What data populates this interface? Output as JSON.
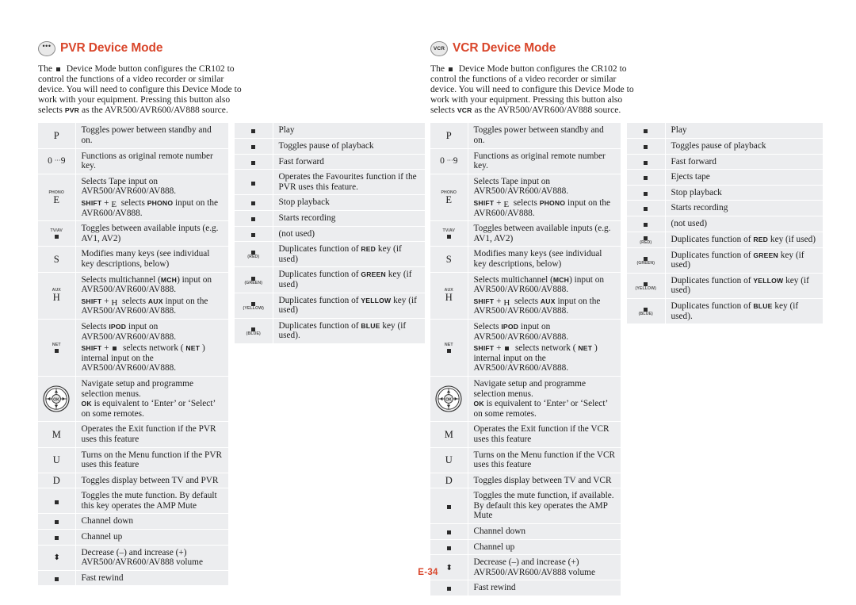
{
  "page": {
    "number": "E-34"
  },
  "sections": [
    {
      "id": "pvr",
      "icon_label": "•••",
      "icon_kind": "dots",
      "title": "PVR Device Mode",
      "intro": {
        "before_key": "The",
        "after_key": "Device Mode button configures the CR102 to control the functions of a video recorder or similar device. You will need to configure this Device Mode to work with your equipment. Pressing this button also selects",
        "source_name": "PVR",
        "tail": "as the AVR500/AVR600/AV888 source."
      },
      "main_rows": [
        {
          "key": {
            "type": "letter",
            "text": "P"
          },
          "lines": [
            {
              "text": "Toggles power between standby and on."
            }
          ]
        },
        {
          "key": {
            "type": "range",
            "from": "0",
            "dots": "···",
            "to": "9"
          },
          "lines": [
            {
              "text": "Functions as original remote number key."
            }
          ]
        },
        {
          "key": {
            "type": "label-letter",
            "tiny": "PHONO",
            "text": "E"
          },
          "lines": [
            {
              "text": "Selects Tape input on AVR500/AVR600/AV888."
            },
            {
              "type": "shift",
              "shift": "SHIFT",
              "plus": "+",
              "keyglyph": "E",
              "mid": "selects",
              "caps": "PHONO",
              "after": "input on the AVR600/AV888."
            }
          ]
        },
        {
          "key": {
            "type": "label-square",
            "tiny": "TV/AV"
          },
          "lines": [
            {
              "text": "Toggles between available inputs (e.g. AV1, AV2)"
            }
          ]
        },
        {
          "key": {
            "type": "letter",
            "text": "S"
          },
          "lines": [
            {
              "text": "Modifies many keys (see individual key descriptions, below)"
            }
          ]
        },
        {
          "key": {
            "type": "label-letter",
            "tiny": "AUX",
            "text": "H"
          },
          "lines": [
            {
              "type": "caps-inline",
              "pre": "Selects multichannel (",
              "caps": "MCH",
              "post": ") input on AVR500/AVR600/AV888."
            },
            {
              "type": "shift",
              "shift": "SHIFT",
              "plus": "+",
              "keyglyph": "H",
              "mid": "selects",
              "caps": "AUX",
              "after": "input on the AVR500/AVR600/AV888."
            }
          ]
        },
        {
          "key": {
            "type": "label-square",
            "tiny": "NET"
          },
          "lines": [
            {
              "type": "caps-inline",
              "pre": "Selects ",
              "caps": "IPOD",
              "post": " input on AVR500/AVR600/AV888."
            },
            {
              "type": "shift",
              "shift": "SHIFT",
              "plus": "+",
              "keyglyph": "square",
              "mid": "selects network (",
              "caps": "NET",
              "after": ") internal input on the AVR500/AVR600/AV888."
            }
          ]
        },
        {
          "key": {
            "type": "navpad"
          },
          "lines": [
            {
              "text": "Navigate setup and programme selection menus."
            },
            {
              "type": "caps-lead",
              "caps": "OK",
              "post": "is equivalent to ‘Enter’ or ‘Select’ on some remotes."
            }
          ]
        },
        {
          "key": {
            "type": "letter",
            "text": "M"
          },
          "lines": [
            {
              "text": "Operates the Exit function if the PVR uses this feature"
            }
          ]
        },
        {
          "key": {
            "type": "letter",
            "text": "U"
          },
          "lines": [
            {
              "text": "Turns on the Menu function if the PVR uses this feature"
            }
          ]
        },
        {
          "key": {
            "type": "letter",
            "text": "D"
          },
          "lines": [
            {
              "text": "Toggles display between TV and PVR"
            }
          ]
        },
        {
          "key": {
            "type": "square"
          },
          "lines": [
            {
              "text": "Toggles the mute function. By default this key operates the AMP Mute"
            }
          ]
        },
        {
          "key": {
            "type": "square"
          },
          "lines": [
            {
              "text": "Channel down"
            }
          ]
        },
        {
          "key": {
            "type": "square"
          },
          "lines": [
            {
              "text": "Channel up"
            }
          ]
        },
        {
          "key": {
            "type": "plusminus"
          },
          "lines": [
            {
              "text": "Decrease (–) and increase (+) AVR500/AVR600/AV888 volume"
            }
          ]
        },
        {
          "key": {
            "type": "square"
          },
          "lines": [
            {
              "text": "Fast rewind"
            }
          ]
        }
      ],
      "aux_rows": [
        {
          "key": {
            "type": "square"
          },
          "lines": [
            {
              "text": "Play"
            }
          ]
        },
        {
          "key": {
            "type": "square"
          },
          "lines": [
            {
              "text": "Toggles pause of playback"
            }
          ]
        },
        {
          "key": {
            "type": "square"
          },
          "lines": [
            {
              "text": "Fast forward"
            }
          ]
        },
        {
          "key": {
            "type": "square"
          },
          "lines": [
            {
              "text": "Operates the Favourites function if the PVR uses this feature."
            }
          ]
        },
        {
          "key": {
            "type": "square"
          },
          "lines": [
            {
              "text": "Stop playback"
            }
          ]
        },
        {
          "key": {
            "type": "square"
          },
          "lines": [
            {
              "text": "Starts recording"
            }
          ]
        },
        {
          "key": {
            "type": "square"
          },
          "lines": [
            {
              "text": "(not used)"
            }
          ]
        },
        {
          "key": {
            "type": "square-label",
            "tiny": "(RED)"
          },
          "lines": [
            {
              "type": "caps-inline",
              "pre": "Duplicates function of ",
              "caps": "RED",
              "post": " key (if used)"
            }
          ]
        },
        {
          "key": {
            "type": "square-label",
            "tiny": "(GREEN)"
          },
          "lines": [
            {
              "type": "caps-inline",
              "pre": "Duplicates function of ",
              "caps": "GREEN",
              "post": " key (if used)"
            }
          ]
        },
        {
          "key": {
            "type": "square-label",
            "tiny": "(YELLOW)"
          },
          "lines": [
            {
              "type": "caps-inline",
              "pre": "Duplicates function of ",
              "caps": "YELLOW",
              "post": " key (if used)"
            }
          ]
        },
        {
          "key": {
            "type": "square-label",
            "tiny": "(BLUE)"
          },
          "lines": [
            {
              "type": "caps-inline",
              "pre": "Duplicates function of ",
              "caps": "BLUE",
              "post": " key (if used)."
            }
          ]
        }
      ]
    },
    {
      "id": "vcr",
      "icon_label": "VCR",
      "icon_kind": "text",
      "title": "VCR Device Mode",
      "intro": {
        "before_key": "The",
        "after_key": "Device Mode button configures the CR102 to control the functions of a video recorder or similar device. You will need to configure this Device Mode to work with your equipment. Pressing this button also selects",
        "source_name": "VCR",
        "tail": "as the AVR500/AVR600/AV888 source."
      },
      "main_rows": [
        {
          "key": {
            "type": "letter",
            "text": "P"
          },
          "lines": [
            {
              "text": "Toggles power between standby and on."
            }
          ]
        },
        {
          "key": {
            "type": "range",
            "from": "0",
            "dots": "···",
            "to": "9"
          },
          "lines": [
            {
              "text": "Functions as original remote number key."
            }
          ]
        },
        {
          "key": {
            "type": "label-letter",
            "tiny": "PHONO",
            "text": "E"
          },
          "lines": [
            {
              "text": "Selects Tape input on AVR500/AVR600/AV888."
            },
            {
              "type": "shift",
              "shift": "SHIFT",
              "plus": "+",
              "keyglyph": "E",
              "mid": "selects",
              "caps": "PHONO",
              "after": "input on the AVR600/AV888."
            }
          ]
        },
        {
          "key": {
            "type": "label-square",
            "tiny": "TV/AV"
          },
          "lines": [
            {
              "text": "Toggles between available inputs (e.g. AV1, AV2)"
            }
          ]
        },
        {
          "key": {
            "type": "letter",
            "text": "S"
          },
          "lines": [
            {
              "text": "Modifies many keys (see individual key descriptions, below)"
            }
          ]
        },
        {
          "key": {
            "type": "label-letter",
            "tiny": "AUX",
            "text": "H"
          },
          "lines": [
            {
              "type": "caps-inline",
              "pre": "Selects multichannel (",
              "caps": "MCH",
              "post": ") input on AVR500/AVR600/AV888."
            },
            {
              "type": "shift",
              "shift": "SHIFT",
              "plus": "+",
              "keyglyph": "H",
              "mid": "selects",
              "caps": "AUX",
              "after": "input on the AVR500/AVR600/AV888."
            }
          ]
        },
        {
          "key": {
            "type": "label-square",
            "tiny": "NET"
          },
          "lines": [
            {
              "type": "caps-inline",
              "pre": "Selects ",
              "caps": "IPOD",
              "post": " input on AVR500/AVR600/AV888."
            },
            {
              "type": "shift",
              "shift": "SHIFT",
              "plus": "+",
              "keyglyph": "square",
              "mid": "selects network (",
              "caps": "NET",
              "after": ") internal input on the AVR500/AVR600/AV888."
            }
          ]
        },
        {
          "key": {
            "type": "navpad"
          },
          "lines": [
            {
              "text": "Navigate setup and programme selection menus."
            },
            {
              "type": "caps-lead",
              "caps": "OK",
              "post": "is equivalent to ‘Enter’ or ‘Select’ on some remotes."
            }
          ]
        },
        {
          "key": {
            "type": "letter",
            "text": "M"
          },
          "lines": [
            {
              "text": "Operates the Exit function if the VCR uses this feature"
            }
          ]
        },
        {
          "key": {
            "type": "letter",
            "text": "U"
          },
          "lines": [
            {
              "text": "Turns on the Menu function if the VCR uses this feature"
            }
          ]
        },
        {
          "key": {
            "type": "letter",
            "text": "D"
          },
          "lines": [
            {
              "text": "Toggles display between TV and VCR"
            }
          ]
        },
        {
          "key": {
            "type": "square"
          },
          "lines": [
            {
              "text": "Toggles the mute function, if available. By default this key operates the AMP Mute"
            }
          ]
        },
        {
          "key": {
            "type": "square"
          },
          "lines": [
            {
              "text": "Channel down"
            }
          ]
        },
        {
          "key": {
            "type": "square"
          },
          "lines": [
            {
              "text": "Channel up"
            }
          ]
        },
        {
          "key": {
            "type": "plusminus"
          },
          "lines": [
            {
              "text": "Decrease (–) and increase (+) AVR500/AVR600/AV888 volume"
            }
          ]
        },
        {
          "key": {
            "type": "square"
          },
          "lines": [
            {
              "text": "Fast rewind"
            }
          ]
        }
      ],
      "aux_rows": [
        {
          "key": {
            "type": "square"
          },
          "lines": [
            {
              "text": "Play"
            }
          ]
        },
        {
          "key": {
            "type": "square"
          },
          "lines": [
            {
              "text": "Toggles pause of playback"
            }
          ]
        },
        {
          "key": {
            "type": "square"
          },
          "lines": [
            {
              "text": "Fast forward"
            }
          ]
        },
        {
          "key": {
            "type": "square"
          },
          "lines": [
            {
              "text": "Ejects tape"
            }
          ]
        },
        {
          "key": {
            "type": "square"
          },
          "lines": [
            {
              "text": "Stop playback"
            }
          ]
        },
        {
          "key": {
            "type": "square"
          },
          "lines": [
            {
              "text": "Starts recording"
            }
          ]
        },
        {
          "key": {
            "type": "square"
          },
          "lines": [
            {
              "text": "(not used)"
            }
          ]
        },
        {
          "key": {
            "type": "square-label",
            "tiny": "(RED)"
          },
          "lines": [
            {
              "type": "caps-inline",
              "pre": "Duplicates function of ",
              "caps": "RED",
              "post": " key (if used)"
            }
          ]
        },
        {
          "key": {
            "type": "square-label",
            "tiny": "(GREEN)"
          },
          "lines": [
            {
              "type": "caps-inline",
              "pre": "Duplicates function of ",
              "caps": "GREEN",
              "post": " key (if used)"
            }
          ]
        },
        {
          "key": {
            "type": "square-label",
            "tiny": "(YELLOW)"
          },
          "lines": [
            {
              "type": "caps-inline",
              "pre": "Duplicates function of ",
              "caps": "YELLOW",
              "post": " key (if used)"
            }
          ]
        },
        {
          "key": {
            "type": "square-label",
            "tiny": "(BLUE)"
          },
          "lines": [
            {
              "type": "caps-inline",
              "pre": "Duplicates function of ",
              "caps": "BLUE",
              "post": " key (if used)."
            }
          ]
        }
      ]
    }
  ],
  "colors": {
    "accent": "#d9462b",
    "row_bg": "#ecedef",
    "text": "#1c1c1c"
  }
}
